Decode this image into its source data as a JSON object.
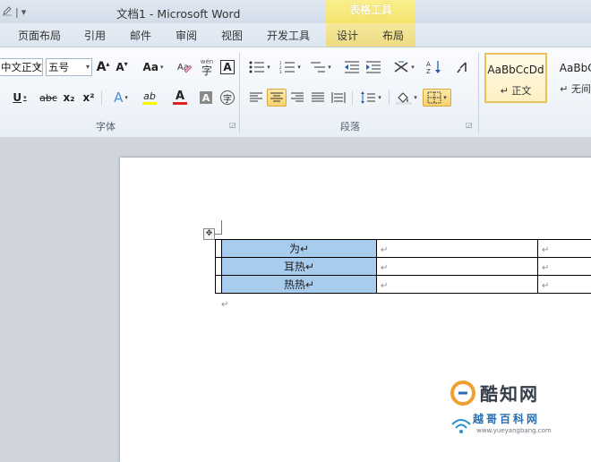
{
  "window": {
    "title": "文档1 - Microsoft Word"
  },
  "quick_access": {
    "icon": "edit-icon",
    "separator": "|",
    "more": "▾"
  },
  "contextual_tab_group": {
    "label": "表格工具",
    "color": "#f4e36b"
  },
  "tabs": [
    "页面布局",
    "引用",
    "邮件",
    "审阅",
    "视图",
    "开发工具",
    "设计",
    "布局"
  ],
  "ribbon": {
    "font": {
      "family": "中文正文",
      "size": "五号",
      "grow": "A",
      "shrink": "A",
      "case": "Aa",
      "pinyin": "wén",
      "border": "A",
      "underline": "U",
      "strike": "abc",
      "subscript": "x₂",
      "superscript": "x²",
      "effects": "A",
      "highlight": "ab",
      "font_color": "A",
      "shading": "A",
      "enclose": "字",
      "label": "字体"
    },
    "paragraph": {
      "label": "段落"
    },
    "styles": [
      {
        "sample": "AaBbCcDd",
        "name": "↵ 正文"
      },
      {
        "sample": "AaBbCc",
        "name": "↵ 无间隔"
      }
    ]
  },
  "colors": {
    "selection": "#a8ccee",
    "active_button": "#f7d26d",
    "ribbon_bg": "#e9eff6"
  },
  "table": {
    "rows": [
      {
        "c1": "为↵",
        "c2": "↵",
        "c3": "↵"
      },
      {
        "c1": "耳热↵",
        "c2": "↵",
        "c3": "↵"
      },
      {
        "c1": "热热↵",
        "c2": "↵",
        "c3": "↵"
      }
    ],
    "move_handle": "✥",
    "after_mark": "↵"
  },
  "watermark": {
    "brand": "酷知网",
    "sub": "越哥百科网",
    "url": "www.yueyangbang.com"
  }
}
